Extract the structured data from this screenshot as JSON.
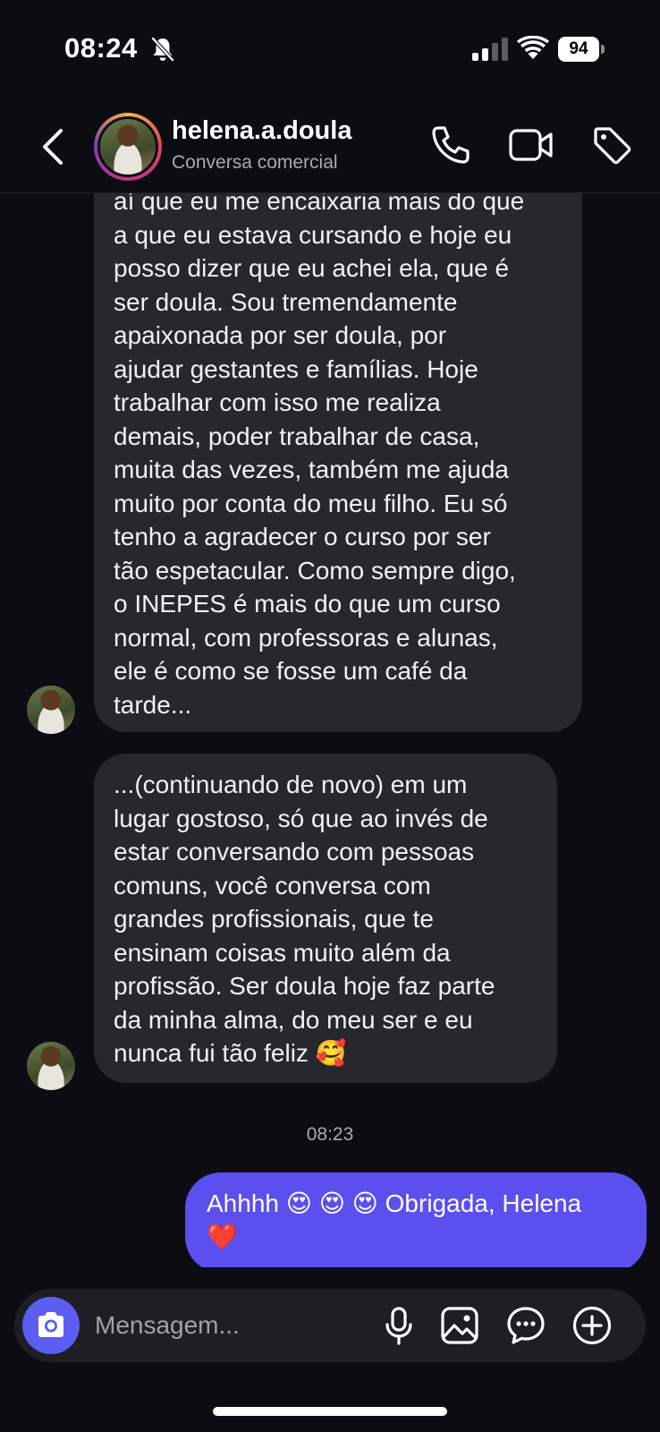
{
  "status_bar": {
    "time": "08:24",
    "battery": "94",
    "icons": [
      "bell-off-icon",
      "cellular-signal-icon",
      "wifi-icon",
      "battery-icon"
    ]
  },
  "header": {
    "contact_name": "helena.a.doula",
    "subtitle": "Conversa comercial",
    "icons": [
      "back-arrow-icon",
      "phone-icon",
      "video-camera-icon",
      "tag-icon"
    ]
  },
  "messages": [
    {
      "from": "contact",
      "lines": [
        "aí que eu me encaixaria mais do que",
        "a que eu estava cursando e hoje eu",
        "posso dizer que eu achei ela, que é",
        "ser doula. Sou tremendamente",
        "apaixonada por ser doula, por",
        "ajudar gestantes e famílias. Hoje",
        "trabalhar com isso me realiza",
        "demais, poder trabalhar de casa,",
        "muita das vezes, também me ajuda",
        "muito por conta do meu filho. Eu só",
        "tenho a agradecer o curso por ser",
        "tão espetacular. Como sempre digo,",
        "o INEPES é mais do que um curso",
        "normal, com professoras e alunas,",
        "ele é como se fosse um café da",
        "tarde..."
      ]
    },
    {
      "from": "contact",
      "lines": [
        "...(continuando de novo) em um",
        "lugar gostoso, só que ao invés de",
        "estar conversando com pessoas",
        "comuns, você conversa com",
        "grandes profissionais, que te",
        "ensinam coisas muito além da",
        "profissão. Ser doula hoje faz parte",
        "da minha alma, do meu ser e eu",
        "nunca fui tão feliz 🥰"
      ]
    },
    {
      "from": "me",
      "timestamp": "08:23",
      "lines": [
        "Ahhhh 😍 😍 😍 Obrigada, Helena",
        "❤️"
      ]
    }
  ],
  "composer": {
    "placeholder": "Mensagem...",
    "icons": [
      "camera-icon",
      "microphone-icon",
      "gallery-icon",
      "sticker-icon",
      "plus-circle-icon"
    ]
  },
  "colors": {
    "background": "#0b0d12",
    "received_bubble": "#26282e",
    "sent_bubble": "#5b4ff0",
    "camera_button": "#5b5ef0",
    "secondary_text": "#a8abb3"
  }
}
